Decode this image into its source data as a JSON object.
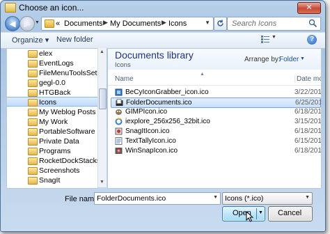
{
  "window": {
    "title": "Choose an icon...",
    "close_glyph": "✕"
  },
  "address": {
    "back_glyph": "◀",
    "forward_glyph": "▶",
    "crumbs": [
      "«",
      "Documents",
      "My Documents",
      "Icons"
    ],
    "separator": "▶",
    "search_placeholder": "Search Icons"
  },
  "toolbar": {
    "organize_label": "Organize ▾",
    "new_folder_label": "New folder",
    "help_glyph": "?"
  },
  "nav_tree": {
    "items": [
      {
        "label": "elex"
      },
      {
        "label": "EventLogs"
      },
      {
        "label": "FileMenuToolsSettings"
      },
      {
        "label": "gegl-0.0"
      },
      {
        "label": "HTGBack"
      },
      {
        "label": "Icons",
        "selected": true
      },
      {
        "label": "My Weblog Posts"
      },
      {
        "label": "My Work"
      },
      {
        "label": "PortableSoftware"
      },
      {
        "label": "Private Data"
      },
      {
        "label": "Programs"
      },
      {
        "label": "RocketDockStacksFolde"
      },
      {
        "label": "Screenshots"
      },
      {
        "label": "SnagIt"
      }
    ]
  },
  "library": {
    "title": "Documents library",
    "subtitle": "Icons",
    "arrange_label": "Arrange by:",
    "arrange_value": "Folder"
  },
  "columns": {
    "name": "Name",
    "date": "Date mod"
  },
  "files": [
    {
      "name": "BeCyIconGrabber_icon.ico",
      "date": "3/22/2012",
      "icon": "becy-icon"
    },
    {
      "name": "FolderDocuments.ico",
      "date": "6/25/2012",
      "icon": "folder-documents-icon",
      "selected": true
    },
    {
      "name": "GIMPIcon.ico",
      "date": "6/18/2012",
      "icon": "gimp-icon"
    },
    {
      "name": "iexplore_256x256_32bit.ico",
      "date": "3/15/2012",
      "icon": "internet-explorer-icon"
    },
    {
      "name": "SnagItIcon.ico",
      "date": "6/18/2012",
      "icon": "snagit-icon"
    },
    {
      "name": "TextTallyIcon.ico",
      "date": "6/15/2012",
      "icon": "text-tally-icon"
    },
    {
      "name": "WinSnapIcon.ico",
      "date": "6/18/2012",
      "icon": "winsnap-icon"
    }
  ],
  "bottom": {
    "filename_label": "File name:",
    "filename_value": "FolderDocuments.ico",
    "filetype_value": "Icons (*.ico)",
    "open_label": "Open",
    "cancel_label": "Cancel"
  }
}
